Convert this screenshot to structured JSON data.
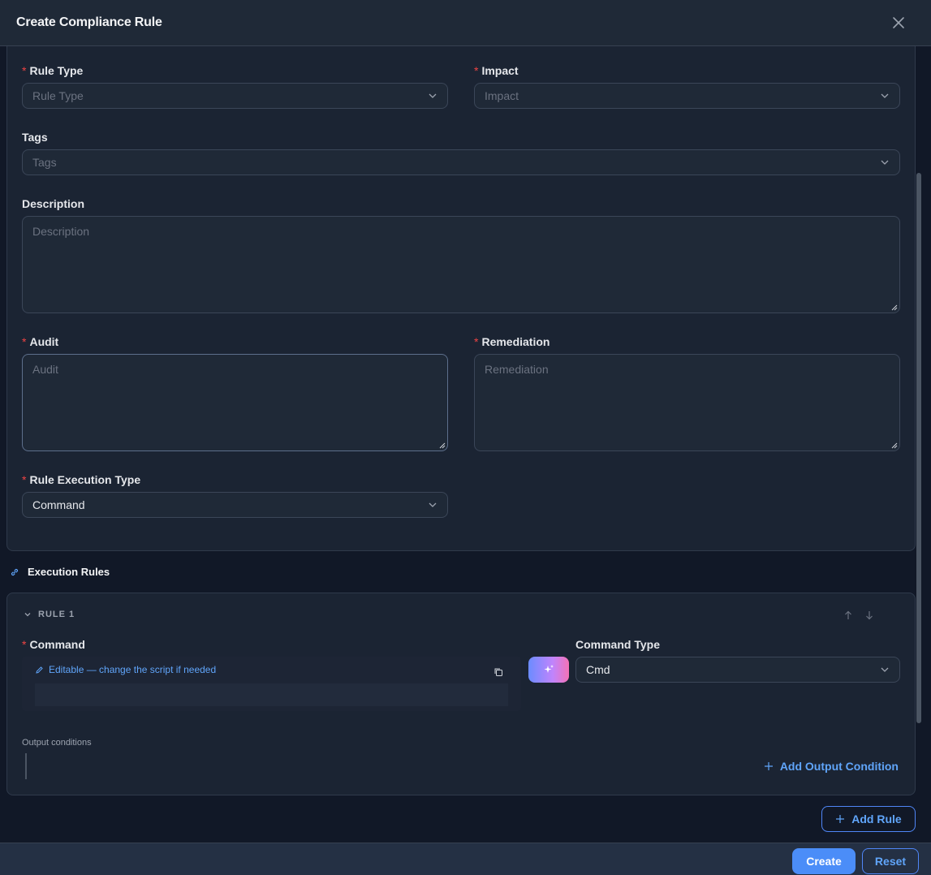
{
  "modal": {
    "title": "Create Compliance Rule"
  },
  "form": {
    "rule_type": {
      "label": "Rule Type",
      "placeholder": "Rule Type",
      "required_mark": "*"
    },
    "impact": {
      "label": "Impact",
      "placeholder": "Impact",
      "required_mark": "*"
    },
    "tags": {
      "label": "Tags",
      "placeholder": "Tags"
    },
    "description": {
      "label": "Description",
      "placeholder": "Description"
    },
    "audit": {
      "label": "Audit",
      "placeholder": "Audit",
      "required_mark": "*"
    },
    "remediation": {
      "label": "Remediation",
      "placeholder": "Remediation",
      "required_mark": "*"
    },
    "rule_execution_type": {
      "label": "Rule Execution Type",
      "value": "Command",
      "required_mark": "*"
    }
  },
  "execution_rules": {
    "heading": "Execution Rules",
    "rules": [
      {
        "title": "RULE 1",
        "command": {
          "label": "Command",
          "required_mark": "*",
          "hint": "Editable — change the script if needed",
          "value": ""
        },
        "command_type": {
          "label": "Command Type",
          "value": "Cmd"
        },
        "output_conditions_label": "Output conditions",
        "add_output_condition_label": "Add Output Condition"
      }
    ],
    "add_rule_label": "Add Rule"
  },
  "footer": {
    "create_label": "Create",
    "reset_label": "Reset"
  },
  "colors": {
    "accent": "#4b8df8",
    "link": "#60a5fa",
    "required": "#ef4444",
    "background": "#111827",
    "card": "#1b2433"
  }
}
